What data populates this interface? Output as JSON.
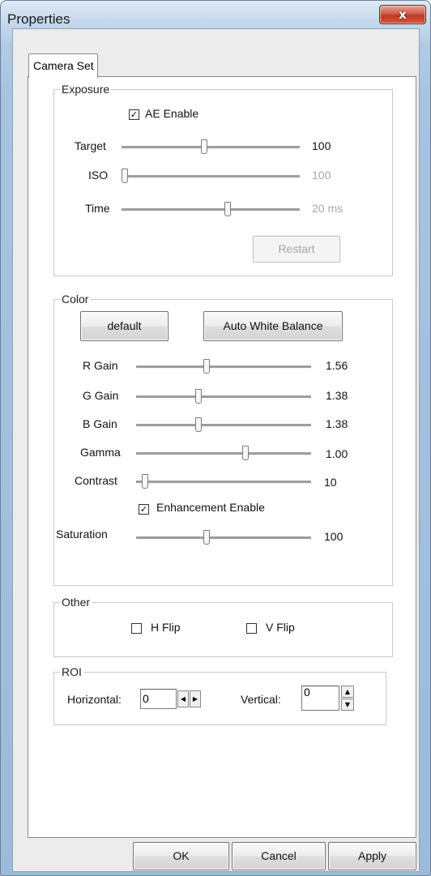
{
  "window": {
    "title": "Properties",
    "close_glyph": "x"
  },
  "tabs": [
    {
      "label": "Camera Set",
      "selected": true
    }
  ],
  "exposure": {
    "legend": "Exposure",
    "ae_enable": {
      "label": "AE Enable",
      "checked": true
    },
    "sliders": [
      {
        "label": "Target",
        "value": "100",
        "level": 0.46,
        "enabled": true
      },
      {
        "label": "ISO",
        "value": "100",
        "level": 0.0,
        "enabled": false
      },
      {
        "label": "Time",
        "value": "20 ms",
        "level": 0.6,
        "enabled": false
      }
    ],
    "restart_label": "Restart"
  },
  "color": {
    "legend": "Color",
    "default_label": "default",
    "awb_label": "Auto White Balance",
    "sliders": [
      {
        "label": "R Gain",
        "value": "1.56",
        "level": 0.4
      },
      {
        "label": "G Gain",
        "value": "1.38",
        "level": 0.35
      },
      {
        "label": "B Gain",
        "value": "1.38",
        "level": 0.35
      },
      {
        "label": "Gamma",
        "value": "1.00",
        "level": 0.63
      },
      {
        "label": "Contrast",
        "value": "10",
        "level": 0.0
      }
    ],
    "enhancement": {
      "label": "Enhancement Enable",
      "checked": true
    },
    "saturation": {
      "label": "Saturation",
      "value": "100",
      "level": 0.4
    }
  },
  "other": {
    "legend": "Other",
    "h_flip": {
      "label": "H Flip",
      "checked": false
    },
    "v_flip": {
      "label": "V Flip",
      "checked": false
    }
  },
  "roi": {
    "legend": "ROI",
    "horizontal_label": "Horizontal:",
    "horizontal_value": "0",
    "vertical_label": "Vertical:",
    "vertical_value": "0"
  },
  "buttons": {
    "ok": "OK",
    "cancel": "Cancel",
    "apply": "Apply"
  }
}
